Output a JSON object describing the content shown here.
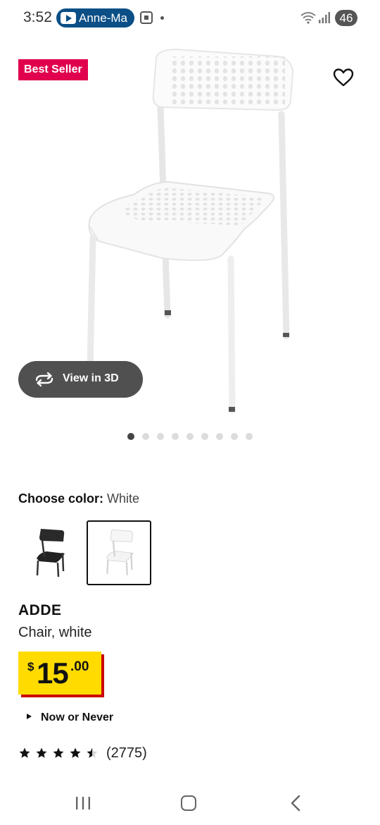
{
  "status_bar": {
    "time": "3:52",
    "media_pill": "Anne-Ma",
    "battery": "46"
  },
  "product_image": {
    "badge": "Best Seller",
    "view_3d_label": "View in 3D",
    "carousel_count": 9,
    "carousel_active_index": 0
  },
  "color_chooser": {
    "label": "Choose color:",
    "selected_value": "White",
    "swatches": [
      "black",
      "white"
    ]
  },
  "product": {
    "name": "ADDE",
    "description": "Chair, white",
    "price_currency": "$",
    "price_integer": "15",
    "price_decimal": ".00",
    "promo": "Now or Never",
    "rating_stars": 4.5,
    "rating_max": 5,
    "review_count": "(2775)"
  },
  "colors": {
    "badge_red": "#e0004d",
    "price_yellow": "#ffdb00",
    "price_shadow_red": "#cc0008",
    "button_dark": "#505050"
  }
}
